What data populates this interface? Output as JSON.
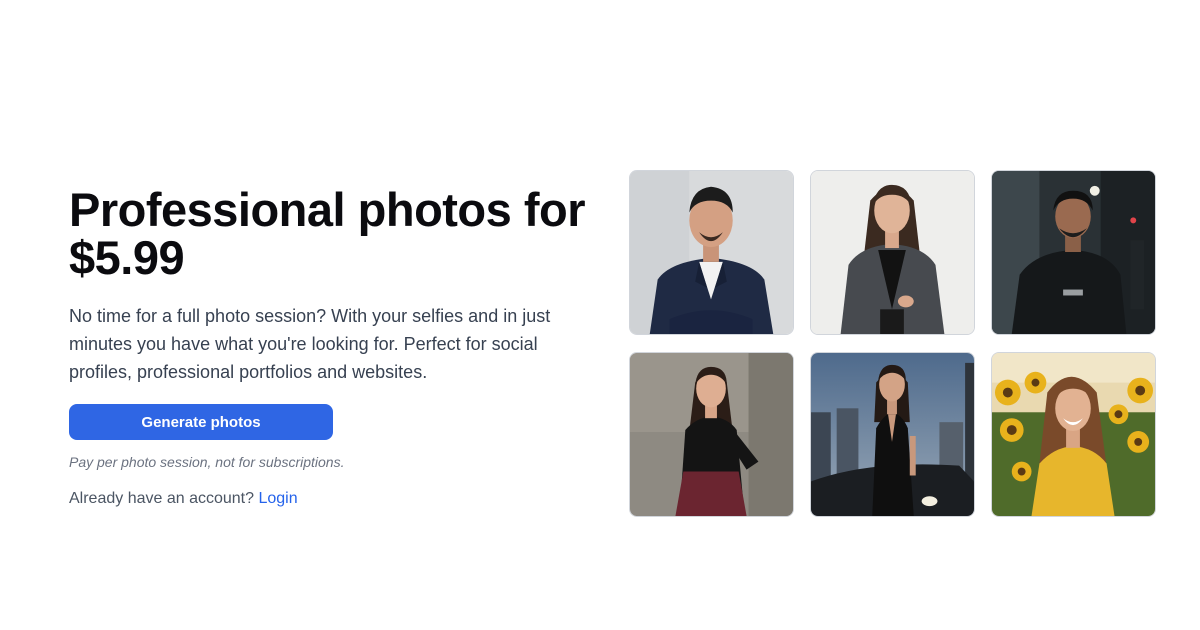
{
  "hero": {
    "headline_line1": "Professional photos for",
    "headline_line2": "$5.99",
    "description": "No time for a full photo session? With your selfies and in just minutes you have what you're looking for. Perfect for social profiles, professional portfolios and websites.",
    "cta_label": "Generate photos",
    "note": "Pay per photo session, not for subscriptions.",
    "account_prompt": "Already have an account?",
    "login_label": "Login"
  },
  "colors": {
    "cta_background": "#2f66e4",
    "link": "#2563eb",
    "headline": "#0b0b0f"
  }
}
